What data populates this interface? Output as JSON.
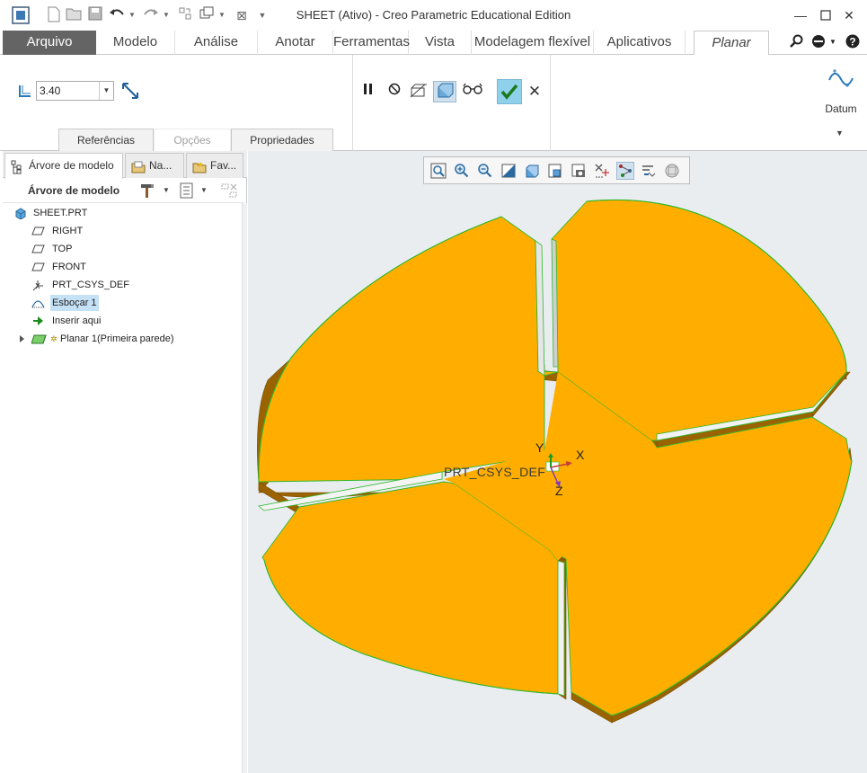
{
  "window": {
    "title": "SHEET (Ativo) - Creo Parametric Educational Edition"
  },
  "quick_access": [
    "app-icon",
    "new-icon",
    "open-icon",
    "save-icon",
    "undo-icon",
    "redo-icon",
    "regenerate-icon",
    "windows-icon",
    "close-window-icon",
    "customize-icon"
  ],
  "tabs": [
    {
      "label": "Arquivo"
    },
    {
      "label": "Modelo"
    },
    {
      "label": "Análise"
    },
    {
      "label": "Anotar"
    },
    {
      "label": "Ferramentas"
    },
    {
      "label": "Vista"
    },
    {
      "label": "Modelagem flexível"
    },
    {
      "label": "Aplicativos"
    },
    {
      "label": "Planar"
    }
  ],
  "ribbon": {
    "thickness_value": "3.40",
    "datum_label": "Datum",
    "subtabs": [
      {
        "label": "Referências",
        "enabled": true
      },
      {
        "label": "Opções",
        "enabled": false
      },
      {
        "label": "Propriedades",
        "enabled": true
      }
    ]
  },
  "navigator": {
    "tabs": [
      {
        "label": "Árvore de modelo"
      },
      {
        "label": "Na..."
      },
      {
        "label": "Fav..."
      }
    ],
    "tree_title": "Árvore de modelo",
    "items": [
      {
        "label": "SHEET.PRT",
        "icon": "part-icon"
      },
      {
        "label": "RIGHT",
        "icon": "datum-plane-icon"
      },
      {
        "label": "TOP",
        "icon": "datum-plane-icon"
      },
      {
        "label": "FRONT",
        "icon": "datum-plane-icon"
      },
      {
        "label": "PRT_CSYS_DEF",
        "icon": "csys-icon"
      },
      {
        "label": "Esboçar 1",
        "icon": "sketch-icon"
      },
      {
        "label": "Inserir aqui",
        "icon": "insert-here-icon"
      },
      {
        "label": "Planar 1(Primeira parede)",
        "icon": "planar-wall-icon"
      }
    ]
  },
  "graphics": {
    "csys_label": "PRT_CSYS_DEF",
    "axis_x": "X",
    "axis_y": "Y",
    "axis_z": "Z",
    "colors": {
      "sheet_face": "#FFAE00",
      "sheet_side": "#9A6300",
      "edge_highlight": "#2DB82D",
      "background": "#EAEDF0"
    }
  }
}
